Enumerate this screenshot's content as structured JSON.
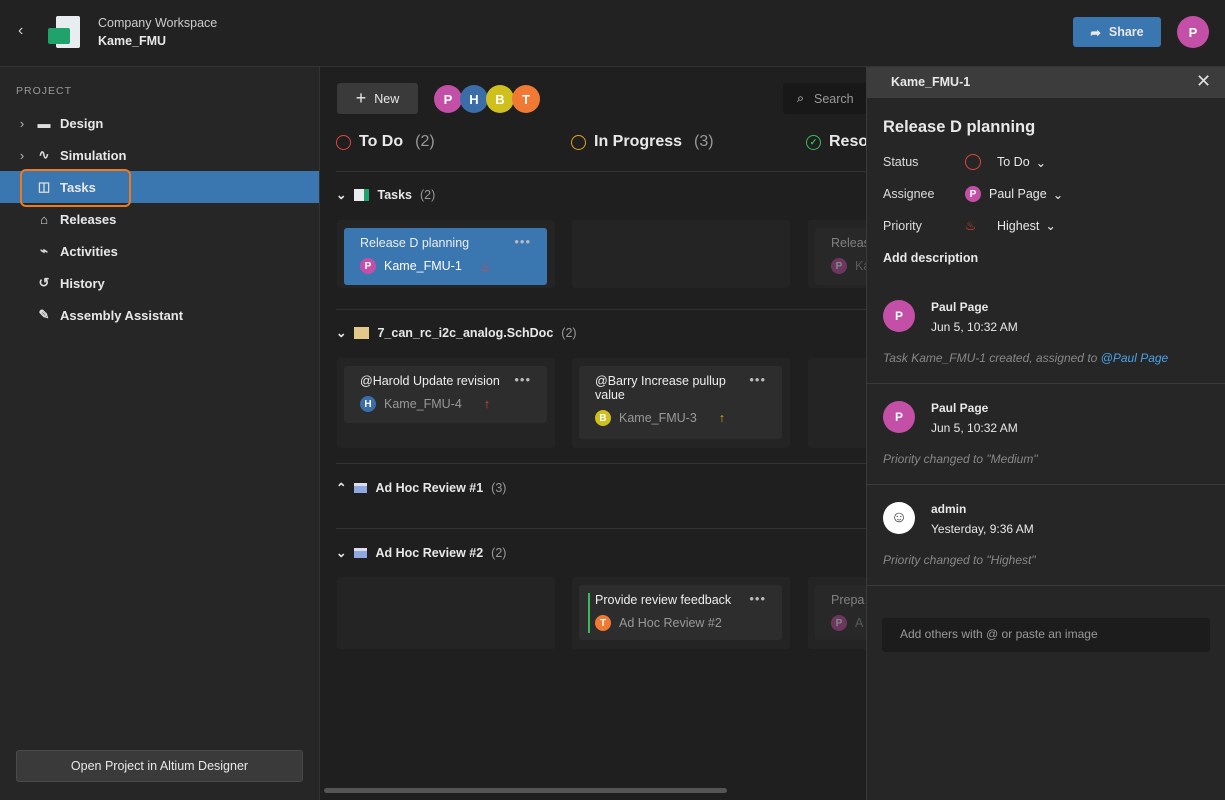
{
  "header": {
    "workspace": "Company Workspace",
    "project": "Kame_FMU",
    "share_label": "Share",
    "user_initial": "P"
  },
  "sidebar": {
    "section": "PROJECT",
    "items": [
      {
        "label": "Design"
      },
      {
        "label": "Simulation"
      },
      {
        "label": "Tasks"
      },
      {
        "label": "Releases"
      },
      {
        "label": "Activities"
      },
      {
        "label": "History"
      },
      {
        "label": "Assembly Assistant"
      }
    ],
    "open_button": "Open Project in Altium Designer"
  },
  "toolbar": {
    "new_label": "New",
    "users": [
      "P",
      "H",
      "B",
      "T"
    ],
    "search_placeholder": "Search"
  },
  "columns": [
    {
      "label": "To Do",
      "count": "(2)"
    },
    {
      "label": "In Progress",
      "count": "(3)"
    },
    {
      "label": "Reso"
    }
  ],
  "groups": [
    {
      "label": "Tasks",
      "count": "(2)"
    },
    {
      "label": "7_can_rc_i2c_analog.SchDoc",
      "count": "(2)"
    },
    {
      "label": "Ad Hoc Review #1",
      "count": "(3)"
    },
    {
      "label": "Ad Hoc Review #2",
      "count": "(2)"
    }
  ],
  "cards": [
    {
      "title": "Release D planning",
      "id": "Kame_FMU-1",
      "initial": "P"
    },
    {
      "title": "Releas",
      "id": "Ka",
      "initial": "P"
    },
    {
      "title": "@Harold Update revision",
      "id": "Kame_FMU-4",
      "initial": "H"
    },
    {
      "title": "@Barry Increase pullup value",
      "id": "Kame_FMU-3",
      "initial": "B"
    },
    {
      "title": "Provide review feedback",
      "id": "Ad Hoc Review #2",
      "initial": "T"
    },
    {
      "title": "Prepa",
      "id": "A",
      "initial": "P"
    }
  ],
  "panel": {
    "header_id": "Kame_FMU-1",
    "title": "Release D planning",
    "status_label": "Status",
    "status": "To Do",
    "assignee_label": "Assignee",
    "assignee": "Paul Page",
    "assignee_initial": "P",
    "priority_label": "Priority",
    "priority": "Highest",
    "add_description": "Add description",
    "activity": [
      {
        "user": "Paul Page",
        "initial": "P",
        "time": "Jun 5, 10:32 AM",
        "text": "Task Kame_FMU-1 created, assigned to ",
        "mention": "@Paul Page"
      },
      {
        "user": "Paul Page",
        "initial": "P",
        "time": "Jun 5, 10:32 AM",
        "text": "Priority changed to \"Medium\""
      },
      {
        "user": "admin",
        "time": "Yesterday, 9:36 AM",
        "text": "Priority changed to \"Highest\""
      }
    ],
    "comment_placeholder": "Add others with @ or paste an image"
  },
  "colors": {
    "accent": "#3a76b0",
    "todo": "#e0463c",
    "inprogress": "#e8a21a",
    "resolved": "#3cb95a",
    "P": "#c44fa6",
    "H": "#3b6ea8",
    "B": "#cfc01e",
    "T": "#f07a34"
  }
}
